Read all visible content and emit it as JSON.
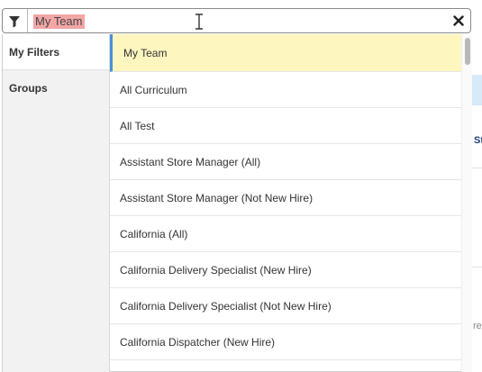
{
  "search": {
    "value": "My Team",
    "placeholder": ""
  },
  "icons": {
    "filter": "filter-icon",
    "clear": "close-icon",
    "cursor": "text-cursor-icon"
  },
  "sidebar": {
    "items": [
      {
        "label": "My Filters"
      },
      {
        "label": "Groups"
      }
    ]
  },
  "options": [
    {
      "label": "My Team",
      "selected": true
    },
    {
      "label": "All Curriculum"
    },
    {
      "label": "All Test"
    },
    {
      "label": "Assistant Store Manager (All)"
    },
    {
      "label": "Assistant Store Manager (Not New Hire)"
    },
    {
      "label": "California (All)"
    },
    {
      "label": "California Delivery Specialist (New Hire)"
    },
    {
      "label": "California Delivery Specialist (Not New Hire)"
    },
    {
      "label": "California Dispatcher (New Hire)"
    }
  ],
  "background": {
    "fragment_1": "St",
    "fragment_2": "re"
  },
  "colors": {
    "selected_bg": "#fdf6bf",
    "selected_accent": "#4a90d9",
    "highlight": "#f2a6a6"
  }
}
